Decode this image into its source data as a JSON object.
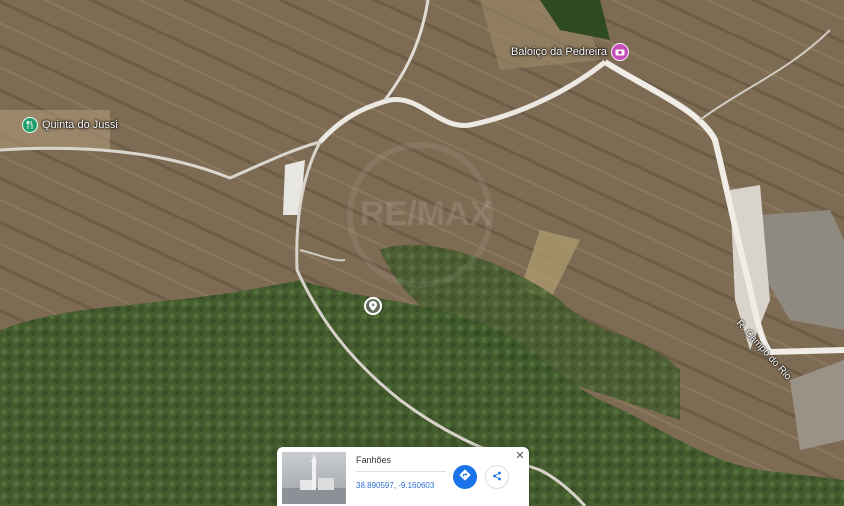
{
  "map": {
    "pois": [
      {
        "label": "Quinta do Jussi",
        "icon": "restaurant-icon"
      },
      {
        "label": "Baloiço da Pedreira",
        "icon": "camera-icon"
      }
    ],
    "road_label": "R. Campo do Rio",
    "watermark": "RE/MAX",
    "center_pin_icon": "location-pin-icon"
  },
  "info_card": {
    "title": "Fanhões",
    "coordinates": "38.890597, -9.160603",
    "directions_icon": "directions-icon",
    "share_icon": "share-icon",
    "close_icon": "close-icon"
  },
  "colors": {
    "terrain": "#7a6a52",
    "vegetation": "#3f5a2c",
    "road": "#e6e3dc",
    "directions_blue": "#1a73e8"
  }
}
